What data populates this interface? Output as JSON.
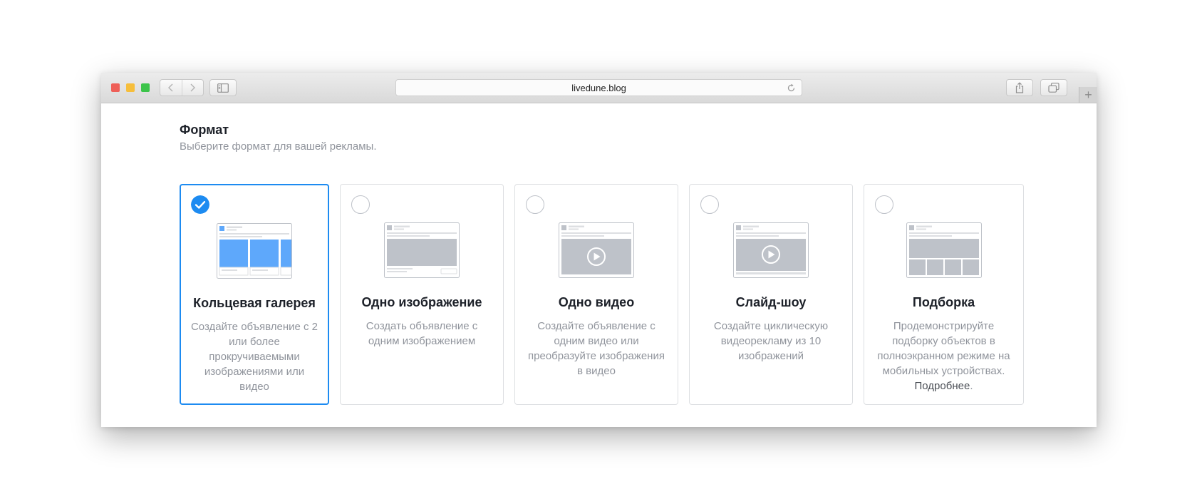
{
  "browser": {
    "url": "livedune.blog"
  },
  "format_section": {
    "title": "Формат",
    "subtitle": "Выберите формат для вашей рекламы."
  },
  "formats": [
    {
      "title": "Кольцевая галерея",
      "description": "Создайте объявление с 2 или более прокручиваемыми изображениями или видео",
      "selected": true,
      "thumbnail": "carousel-thumbnail"
    },
    {
      "title": "Одно изображение",
      "description": "Создать объявление с одним изображением",
      "selected": false,
      "thumbnail": "single-image-thumbnail"
    },
    {
      "title": "Одно видео",
      "description": "Создайте объявление с одним видео или преобразуйте изображения в видео",
      "selected": false,
      "thumbnail": "single-video-thumbnail"
    },
    {
      "title": "Слайд-шоу",
      "description": "Создайте циклическую видеорекламу из 10 изображений",
      "selected": false,
      "thumbnail": "slideshow-thumbnail"
    },
    {
      "title": "Подборка",
      "description": "Продемонстрируйте подборку объектов в полноэкранном режиме на мобильных устройствах.",
      "link": "Подробнее",
      "selected": false,
      "thumbnail": "collection-thumbnail"
    }
  ],
  "colors": {
    "accent": "#1d8bf1",
    "selected_thumbnail": "#5ea8fb",
    "placeholder": "#bec2c9"
  }
}
